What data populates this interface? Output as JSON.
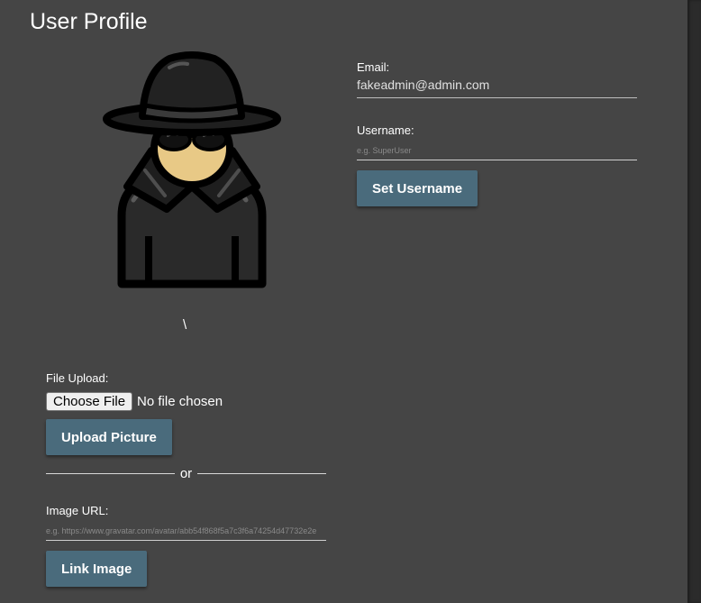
{
  "page": {
    "title": "User Profile"
  },
  "avatar": {
    "icon": "spy-avatar-icon",
    "caption": "\\"
  },
  "upload": {
    "label": "File Upload:",
    "choose_button": "Choose File",
    "status": "No file chosen",
    "submit_label": "Upload Picture"
  },
  "divider": {
    "text": "or"
  },
  "image_url": {
    "label": "Image URL:",
    "placeholder": "e.g. https://www.gravatar.com/avatar/abb54f868f5a7c3f6a74254d47732e2e",
    "value": "",
    "submit_label": "Link Image"
  },
  "email": {
    "label": "Email:",
    "value": "fakeadmin@admin.com"
  },
  "username": {
    "label": "Username:",
    "placeholder": "e.g. SuperUser",
    "value": "",
    "submit_label": "Set Username"
  },
  "colors": {
    "background": "#454545",
    "button": "#4a6b7c",
    "scrollbar": "#2b2b2b"
  }
}
